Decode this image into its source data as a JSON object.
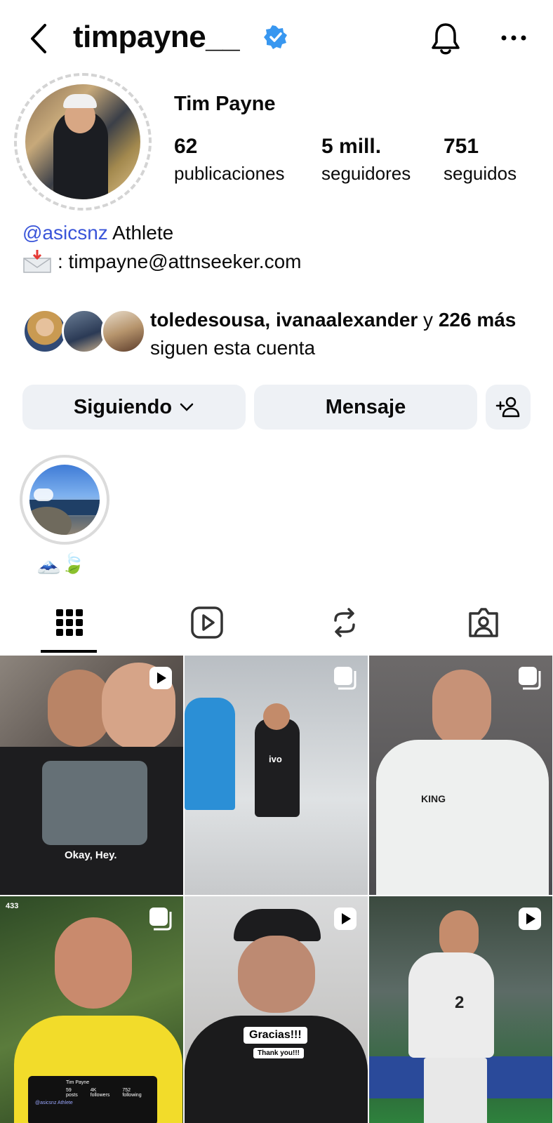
{
  "header": {
    "username": "timpayne__",
    "verified": true,
    "icons": [
      "back-arrow-icon",
      "verified-badge-icon",
      "bell-icon",
      "more-icon"
    ]
  },
  "profile": {
    "full_name": "Tim Payne",
    "stats": [
      {
        "value": "62",
        "label": "publicaciones"
      },
      {
        "value": "5 mill.",
        "label": "seguidores"
      },
      {
        "value": "751",
        "label": "seguidos"
      }
    ],
    "bio": {
      "mention": "@asicsnz",
      "line1_rest": " Athlete",
      "line2": ": timpayne@attnseeker.com"
    },
    "followed_by": {
      "names": "toledesousa, ivanaalexander",
      "connector": " y ",
      "more": "226 más",
      "suffix": " siguen esta cuenta"
    }
  },
  "actions": {
    "following_label": "Siguiendo",
    "message_label": "Mensaje"
  },
  "highlights": [
    {
      "label": "🗻🍃"
    }
  ],
  "tabs": [
    "grid-icon",
    "reels-icon",
    "reposts-icon",
    "tagged-icon"
  ],
  "posts": [
    {
      "type": "reel",
      "caption": "Okay, Hey."
    },
    {
      "type": "carousel",
      "caption": "ivo"
    },
    {
      "type": "carousel",
      "caption": "KING"
    },
    {
      "type": "carousel",
      "caption": "433",
      "overlay": {
        "name": "Tim Payne",
        "stats": [
          {
            "v": "59",
            "l": "posts"
          },
          {
            "v": "4K",
            "l": "followers"
          },
          {
            "v": "752",
            "l": "following"
          }
        ],
        "mention": "@asicsnz Athlete"
      }
    },
    {
      "type": "reel",
      "caption": "Gracias!!!",
      "sub": "Thank you!!!"
    },
    {
      "type": "reel",
      "caption": "2"
    }
  ],
  "colors": {
    "mention": "#3a55d9",
    "verified": "#3897f0",
    "button_bg": "#eef1f5"
  }
}
